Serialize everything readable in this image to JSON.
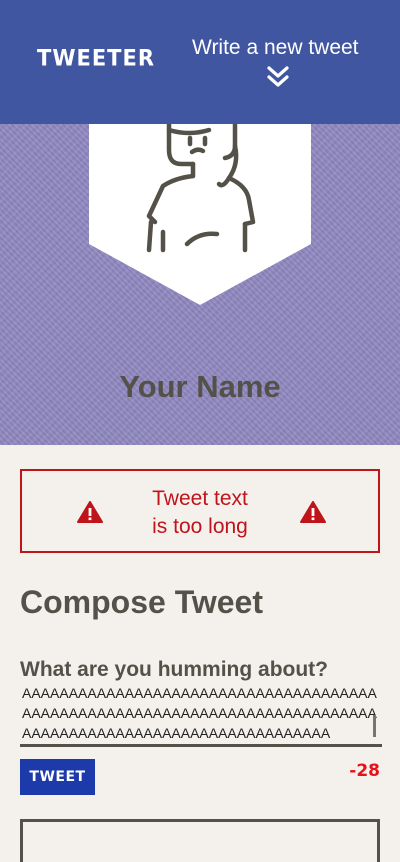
{
  "header": {
    "brand": "TWEETER",
    "compose_link": "Write a new tweet",
    "chevron_icon": "double-chevron-down-icon",
    "background": "#4056a1"
  },
  "profile": {
    "avatar_icon": "user-avatar-icon",
    "name": "Your Name",
    "background": "#8f87c0"
  },
  "error": {
    "line1": "Tweet text",
    "line2": "is too long",
    "icon": "warning-icon",
    "color": "#c0141b"
  },
  "compose": {
    "title": "Compose Tweet",
    "label": "What are you humming about?",
    "value": "AAAAAAAAAAAAAAAAAAAAAAAAAAAAAAAAAAAAAAAAAAAAAAAAAAAAAAAAAAAAAAAAAAAAAAAAAAAAAAAAAAAAAAAAAAAAAAAAAAAAAAAAAAAAA",
    "button_label": "TWEET",
    "counter": "-28",
    "counter_color": "#e8101a",
    "button_color": "#1d3aaa"
  }
}
